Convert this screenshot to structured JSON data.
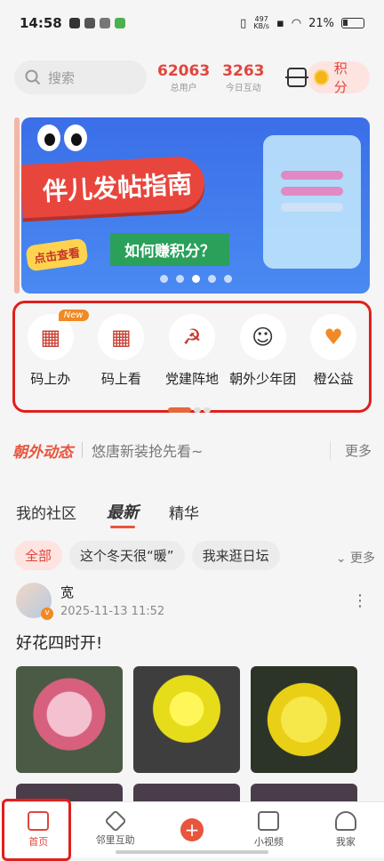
{
  "status_bar": {
    "time": "14:58",
    "net_speed": "497",
    "net_unit": "KB/s",
    "battery": "21%"
  },
  "header": {
    "search_placeholder": "搜索",
    "total_users_value": "62063",
    "total_users_label": "总用户",
    "today_interactions_value": "3263",
    "today_interactions_label": "今日互动",
    "points_label": "积分"
  },
  "banner": {
    "title": "伴儿发帖指南",
    "sub1": "点击查看",
    "sub2": "如何赚积分？",
    "dot_count": 5,
    "active_dot": 2
  },
  "quick_actions": {
    "new_badge": "New",
    "items": [
      {
        "label": "码上办",
        "icon": "chaowai-office-icon"
      },
      {
        "label": "码上看",
        "icon": "chaowai-view-icon"
      },
      {
        "label": "党建阵地",
        "icon": "party-emblem-icon"
      },
      {
        "label": "朝外少年团",
        "icon": "kid-face-icon"
      },
      {
        "label": "橙公益",
        "icon": "hand-orange-icon"
      }
    ]
  },
  "news": {
    "brand": "朝外动态",
    "headline": "悠唐新装抢先看~",
    "more": "更多"
  },
  "tabs": [
    {
      "label": "我的社区"
    },
    {
      "label": "最新",
      "active": true
    },
    {
      "label": "精华"
    }
  ],
  "chips": [
    {
      "label": "全部",
      "active": true
    },
    {
      "label": "这个冬天很“暖”"
    },
    {
      "label": "我来逛日坛"
    }
  ],
  "chips_more": "更多",
  "post": {
    "author": "宽",
    "time": "2025-11-13 11:52",
    "text": "好花四时开!"
  },
  "bottom_nav": [
    {
      "label": "首页",
      "active": true
    },
    {
      "label": "邻里互助"
    },
    {
      "label": ""
    },
    {
      "label": "小视频"
    },
    {
      "label": "我家"
    }
  ],
  "colors": {
    "accent": "#e0463c",
    "highlight_border": "#e0201c"
  }
}
